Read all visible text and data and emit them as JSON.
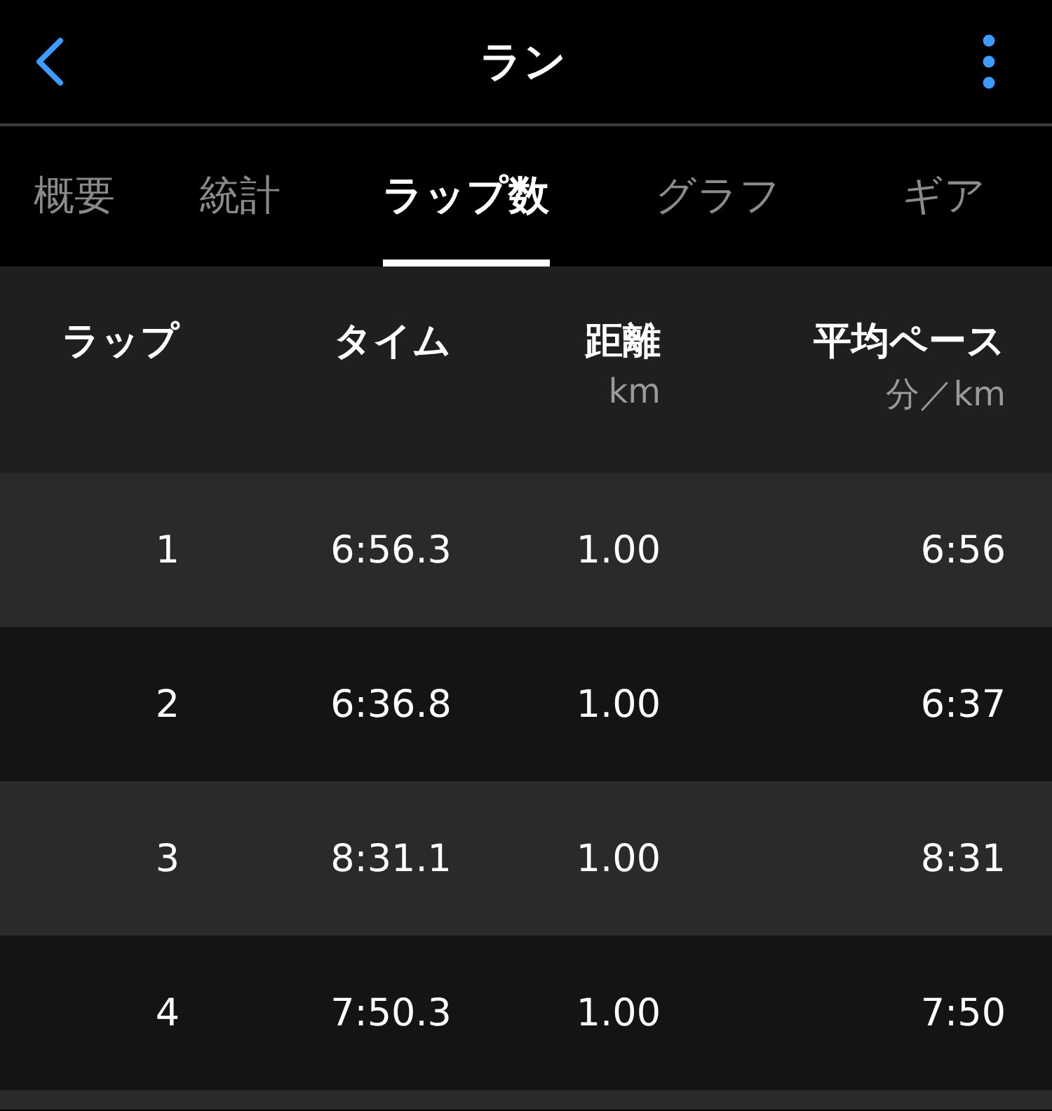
{
  "header": {
    "title": "ラン"
  },
  "tabs": [
    {
      "label": "概要",
      "selected": false
    },
    {
      "label": "統計",
      "selected": false
    },
    {
      "label": "ラップ数",
      "selected": true
    },
    {
      "label": "グラフ",
      "selected": false
    },
    {
      "label": "ギア",
      "selected": false
    }
  ],
  "table": {
    "columns": [
      {
        "label": "ラップ"
      },
      {
        "label": "タイム"
      },
      {
        "label": "距離",
        "unit": "km"
      },
      {
        "label": "平均ペース",
        "unit": "分／km"
      }
    ],
    "rows": [
      {
        "lap": "1",
        "time": "6:56.3",
        "distance": "1.00",
        "pace": "6:56"
      },
      {
        "lap": "2",
        "time": "6:36.8",
        "distance": "1.00",
        "pace": "6:37"
      },
      {
        "lap": "3",
        "time": "8:31.1",
        "distance": "1.00",
        "pace": "8:31"
      },
      {
        "lap": "4",
        "time": "7:50.3",
        "distance": "1.00",
        "pace": "7:50"
      }
    ]
  }
}
